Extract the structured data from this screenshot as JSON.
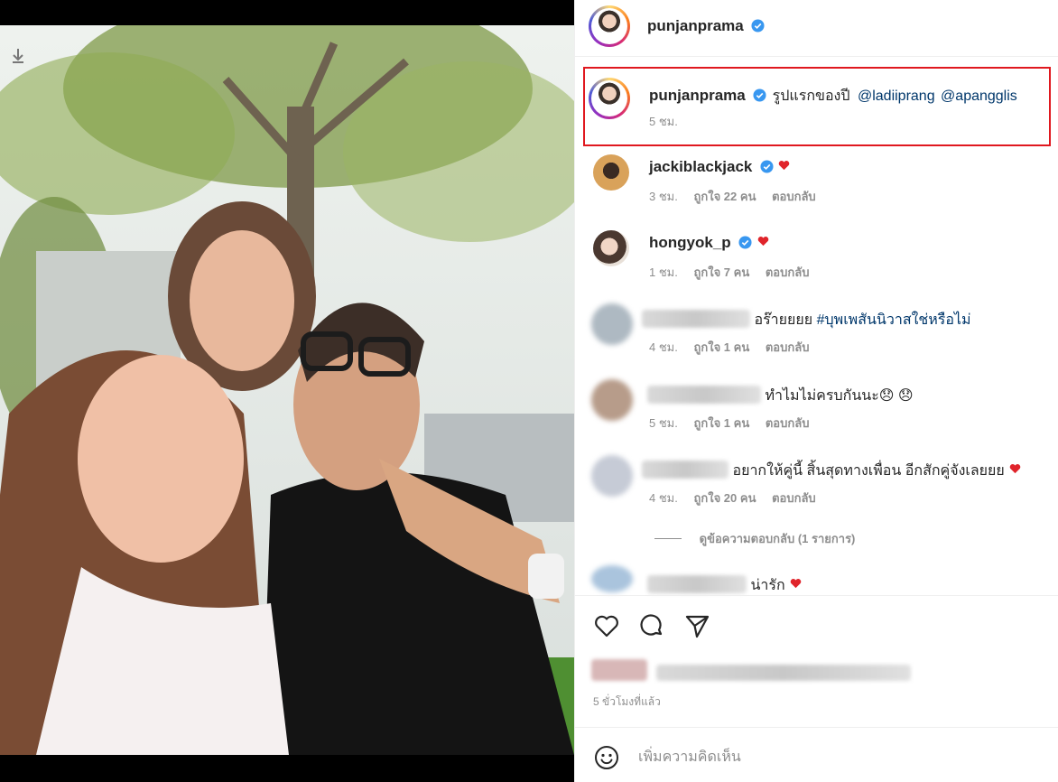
{
  "post": {
    "author": "punjanprama",
    "timestamp": "5 ขั่วโมงที่แล้ว"
  },
  "caption": {
    "author": "punjanprama",
    "text": "รูปแรกของปี",
    "mentions": [
      "@ladiiprang",
      "@apangglis"
    ],
    "time": "5 ชม."
  },
  "comments": [
    {
      "author": "jackiblackjack",
      "verified": true,
      "text": "",
      "time": "3 ชม.",
      "likes": "ถูกใจ 22 คน",
      "reply": "ตอบกลับ"
    },
    {
      "author": "hongyok_p",
      "verified": true,
      "text": "",
      "time": "1 ชม.",
      "likes": "ถูกใจ 7 คน",
      "reply": "ตอบกลับ"
    },
    {
      "author": "",
      "text": "อร๊ายยยย",
      "hashtag": "#บุพเพสันนิวาสใช่หรือไม่",
      "time": "4 ชม.",
      "likes": "ถูกใจ 1 คน",
      "reply": "ตอบกลับ"
    },
    {
      "author": "",
      "text": "ทำไมไม่ครบกันนะ😞 😞",
      "time": "5 ชม.",
      "likes": "ถูกใจ 1 คน",
      "reply": "ตอบกลับ"
    },
    {
      "author": "",
      "text": "อยากให้คู่นี้ สิ้นสุดทางเพื่อน อีกสักคู่จังเลยยย",
      "time": "4 ชม.",
      "likes": "ถูกใจ 20 คน",
      "reply": "ตอบกลับ",
      "view_replies": "ดูข้อความตอบกลับ (1 รายการ)"
    },
    {
      "author": "",
      "text": "น่ารัก"
    }
  ],
  "composer": {
    "placeholder": "เพิ่มความคิดเห็น"
  },
  "icons": {
    "like": "heart-icon",
    "comment": "comment-bubble-icon",
    "share": "paper-plane-icon",
    "emoji": "smiley-icon",
    "verified": "verified-badge-icon"
  },
  "colors": {
    "verified": "#3897f0",
    "highlight": "#e0181f",
    "link": "#00376b",
    "muted": "#8e8e8e"
  }
}
